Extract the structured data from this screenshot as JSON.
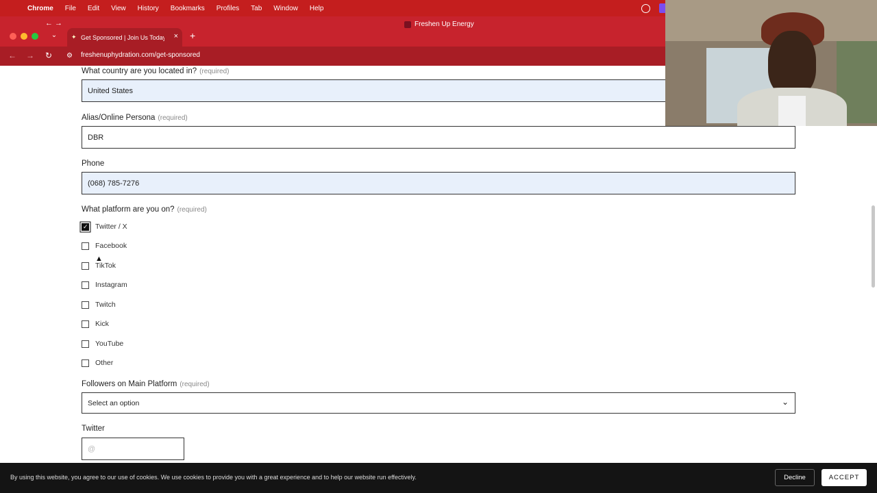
{
  "menubar": {
    "items": [
      "Chrome",
      "File",
      "Edit",
      "View",
      "History",
      "Bookmarks",
      "Profiles",
      "Tab",
      "Window",
      "Help"
    ]
  },
  "browser": {
    "tab_title": "Get Sponsored | Join Us Today",
    "window_title": "Freshen Up Energy",
    "url": "freshenuphydration.com/get-sponsored",
    "new_tab": "+",
    "tab_close": "×"
  },
  "form": {
    "country": {
      "label": "What country are you located in?",
      "required": "(required)",
      "value": "United States"
    },
    "alias": {
      "label": "Alias/Online Persona",
      "required": "(required)",
      "value": "DBR"
    },
    "phone": {
      "label": "Phone",
      "value": "(068) 785-7276"
    },
    "platform": {
      "label": "What platform are you on?",
      "required": "(required)",
      "options": [
        {
          "label": "Twitter / X",
          "checked": true
        },
        {
          "label": "Facebook",
          "checked": false
        },
        {
          "label": "TikTok",
          "checked": false
        },
        {
          "label": "Instagram",
          "checked": false
        },
        {
          "label": "Twitch",
          "checked": false
        },
        {
          "label": "Kick",
          "checked": false
        },
        {
          "label": "YouTube",
          "checked": false
        },
        {
          "label": "Other",
          "checked": false
        }
      ]
    },
    "followers": {
      "label": "Followers on Main Platform",
      "required": "(required)",
      "value": "Select an option"
    },
    "twitter": {
      "label": "Twitter",
      "placeholder": "@"
    }
  },
  "cookie": {
    "message": "By using this website, you agree to our use of cookies. We use cookies to provide you with a great experience and to help our website run effectively.",
    "decline": "Decline",
    "accept": "ACCEPT"
  },
  "icons": {
    "apple": "apple-icon",
    "reload": "reload-icon",
    "site_info": "site-info-icon",
    "chevron": "chevron-down-icon"
  }
}
